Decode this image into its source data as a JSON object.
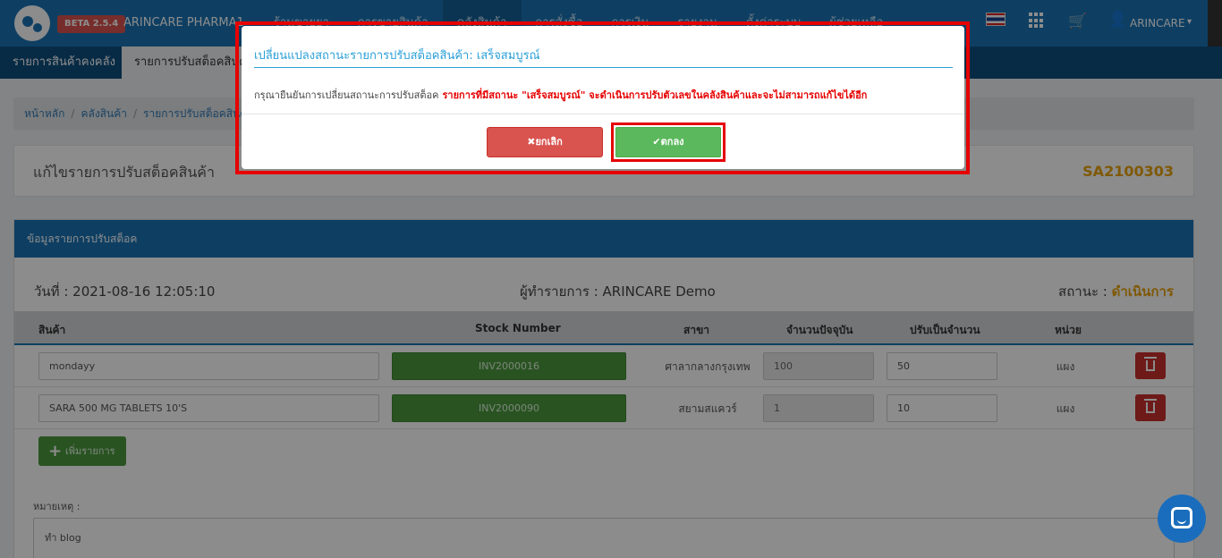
{
  "navbar": {
    "beta_badge": "BETA 2.5.4",
    "brand_name": "ARINCARE PHARMA1",
    "menu": [
      "ร้านขายยา",
      "การขายสินค้า",
      "คลังสินค้า",
      "การสั่งซื้อ",
      "การเงิน",
      "รายงาน",
      "ตั้งค่าระบบ",
      "ผู้ช่วยเหลือ"
    ],
    "user_name": "ARINCARE",
    "user_caret": "▾"
  },
  "subnav": {
    "tab_1": "รายการสินค้าคงคลัง",
    "tab_2": "รายการปรับสต็อคสินค้า"
  },
  "breadcrumb": {
    "home": "หน้าหลัก",
    "warehouse": "คลังสินค้า",
    "current": "รายการปรับสต็อคสินค้า",
    "separator": "/"
  },
  "title_card": {
    "title": "แก้ไขรายการปรับสต็อคสินค้า",
    "doc_no": "SA2100303"
  },
  "panel": {
    "heading": "ข้อมูลรายการปรับสต็อค",
    "date_label": "วันที่ : 2021-08-16 12:05:10",
    "operator_label": "ผู้ทำรายการ : ARINCARE Demo",
    "status_label": "สถานะ :",
    "status_value": "ดำเนินการ",
    "columns": {
      "product": "สินค้า",
      "stock_number": "Stock Number",
      "branch": "สาขา",
      "current_qty": "จำนวนปัจจุบัน",
      "adjust_qty": "ปรับเป็นจำนวน",
      "unit": "หน่วย"
    },
    "rows": [
      {
        "product": "mondayy",
        "stock_number": "INV2000016",
        "branch": "ศาลากลางกรุงเทพ",
        "current_qty": "100",
        "adjust_qty": "50",
        "unit": "แผง"
      },
      {
        "product": "SARA 500 MG TABLETS 10'S",
        "stock_number": "INV2000090",
        "branch": "สยามสแควร์",
        "current_qty": "1",
        "adjust_qty": "10",
        "unit": "แผง"
      }
    ],
    "add_button": "เพิ่มรายการ",
    "note_label": "หมายเหตุ :",
    "note_value": "ทำ blog"
  },
  "modal": {
    "title": "เปลี่ยนแปลงสถานะรายการปรับสต็อคสินค้า: เสร็จสมบูรณ์",
    "body": "กรุณายืนยันการเปลี่ยนสถานะการปรับสต็อค",
    "warning": "รายการที่มีสถานะ \"เสร็จสมบูรณ์\" จะดำเนินการปรับตัวเลขในคลังสินค้าและจะไม่สามารถแก้ไขได้อีก",
    "cancel_label": "✖ยกเลิก",
    "ok_label": "✔ตกลง"
  },
  "icons": {
    "cart": "cart-icon",
    "user": "user-icon",
    "apps": "apps-grid-icon",
    "trash": "trash-icon",
    "chat": "chat-icon"
  },
  "colors": {
    "navbar": "#1b73b5",
    "subnav": "#0f4f7f",
    "status": "#e8a20c",
    "danger": "#d9534f",
    "success": "#5cb85c",
    "highlight": "#e60000"
  }
}
